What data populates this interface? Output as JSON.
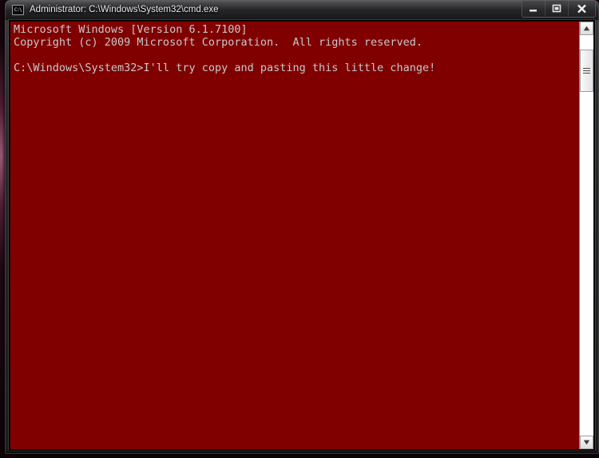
{
  "desktop": {
    "wallpaper_accent": "#b2467f",
    "background": "#1a060e"
  },
  "window": {
    "title": "Administrator: C:\\Windows\\System32\\cmd.exe",
    "app_icon_label": "C:\\",
    "titlebar_color": "#252528",
    "buttons": {
      "minimize_tooltip": "Minimize",
      "maximize_tooltip": "Maximize",
      "close_tooltip": "Close"
    }
  },
  "console": {
    "background_color": "#800000",
    "text_color": "#c8c8c8",
    "lines": [
      "Microsoft Windows [Version 6.1.7100]",
      "Copyright (c) 2009 Microsoft Corporation.  All rights reserved.",
      "",
      "C:\\Windows\\System32>I'll try copy and pasting this little change!"
    ],
    "text": "Microsoft Windows [Version 6.1.7100]\nCopyright (c) 2009 Microsoft Corporation.  All rights reserved.\n\nC:\\Windows\\System32>I'll try copy and pasting this little change!"
  },
  "scrollbar": {
    "orientation": "vertical",
    "up_arrow": "▲",
    "down_arrow": "▼"
  }
}
